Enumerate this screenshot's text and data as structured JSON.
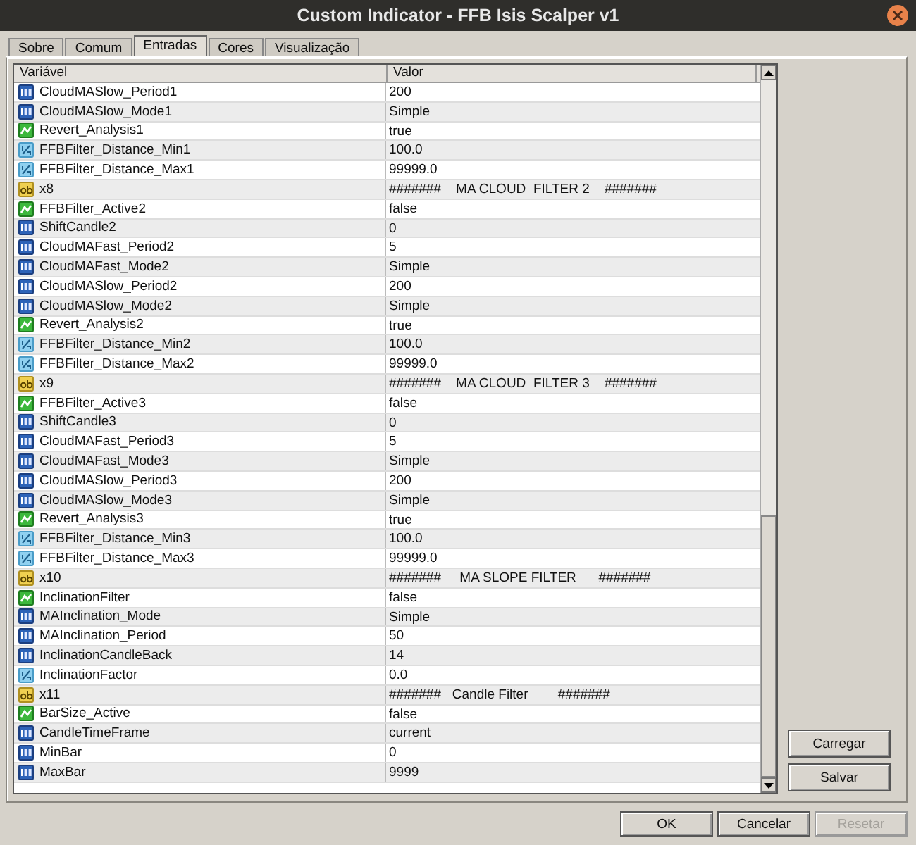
{
  "window": {
    "title": "Custom Indicator - FFB Isis Scalper v1"
  },
  "tabs": [
    {
      "label": "Sobre",
      "selected": false
    },
    {
      "label": "Comum",
      "selected": false
    },
    {
      "label": "Entradas",
      "selected": true
    },
    {
      "label": "Cores",
      "selected": false
    },
    {
      "label": "Visualização",
      "selected": false
    }
  ],
  "table": {
    "columns": [
      "Variável",
      "Valor"
    ],
    "rows": [
      {
        "kind": "int",
        "name": "CloudMASlow_Period1",
        "value": "200"
      },
      {
        "kind": "int",
        "name": "CloudMASlow_Mode1",
        "value": "Simple"
      },
      {
        "kind": "bool",
        "name": "Revert_Analysis1",
        "value": "true"
      },
      {
        "kind": "double",
        "name": "FFBFilter_Distance_Min1",
        "value": "100.0"
      },
      {
        "kind": "double",
        "name": "FFBFilter_Distance_Max1",
        "value": "99999.0"
      },
      {
        "kind": "string",
        "name": "x8",
        "value": "#######    MA CLOUD  FILTER 2    #######"
      },
      {
        "kind": "bool",
        "name": "FFBFilter_Active2",
        "value": "false"
      },
      {
        "kind": "int",
        "name": "ShiftCandle2",
        "value": "0"
      },
      {
        "kind": "int",
        "name": "CloudMAFast_Period2",
        "value": "5"
      },
      {
        "kind": "int",
        "name": "CloudMAFast_Mode2",
        "value": "Simple"
      },
      {
        "kind": "int",
        "name": "CloudMASlow_Period2",
        "value": "200"
      },
      {
        "kind": "int",
        "name": "CloudMASlow_Mode2",
        "value": "Simple"
      },
      {
        "kind": "bool",
        "name": "Revert_Analysis2",
        "value": "true"
      },
      {
        "kind": "double",
        "name": "FFBFilter_Distance_Min2",
        "value": "100.0"
      },
      {
        "kind": "double",
        "name": "FFBFilter_Distance_Max2",
        "value": "99999.0"
      },
      {
        "kind": "string",
        "name": "x9",
        "value": "#######    MA CLOUD  FILTER 3    #######"
      },
      {
        "kind": "bool",
        "name": "FFBFilter_Active3",
        "value": "false"
      },
      {
        "kind": "int",
        "name": "ShiftCandle3",
        "value": "0"
      },
      {
        "kind": "int",
        "name": "CloudMAFast_Period3",
        "value": "5"
      },
      {
        "kind": "int",
        "name": "CloudMAFast_Mode3",
        "value": "Simple"
      },
      {
        "kind": "int",
        "name": "CloudMASlow_Period3",
        "value": "200"
      },
      {
        "kind": "int",
        "name": "CloudMASlow_Mode3",
        "value": "Simple"
      },
      {
        "kind": "bool",
        "name": "Revert_Analysis3",
        "value": "true"
      },
      {
        "kind": "double",
        "name": "FFBFilter_Distance_Min3",
        "value": "100.0"
      },
      {
        "kind": "double",
        "name": "FFBFilter_Distance_Max3",
        "value": "99999.0"
      },
      {
        "kind": "string",
        "name": "x10",
        "value": "#######     MA SLOPE FILTER      #######"
      },
      {
        "kind": "bool",
        "name": "InclinationFilter",
        "value": "false"
      },
      {
        "kind": "int",
        "name": "MAInclination_Mode",
        "value": "Simple"
      },
      {
        "kind": "int",
        "name": "MAInclination_Period",
        "value": "50"
      },
      {
        "kind": "int",
        "name": "InclinationCandleBack",
        "value": "14"
      },
      {
        "kind": "double",
        "name": "InclinationFactor",
        "value": "0.0"
      },
      {
        "kind": "string",
        "name": "x11",
        "value": "#######   Candle Filter        #######"
      },
      {
        "kind": "bool",
        "name": "BarSize_Active",
        "value": "false"
      },
      {
        "kind": "int",
        "name": "CandleTimeFrame",
        "value": "current"
      },
      {
        "kind": "int",
        "name": "MinBar",
        "value": "0"
      },
      {
        "kind": "int",
        "name": "MaxBar",
        "value": "9999"
      }
    ]
  },
  "side_buttons": [
    "Carregar",
    "Salvar"
  ],
  "footer_buttons": [
    {
      "label": "OK",
      "disabled": false
    },
    {
      "label": "Cancelar",
      "disabled": false
    },
    {
      "label": "Resetar",
      "disabled": true
    }
  ]
}
